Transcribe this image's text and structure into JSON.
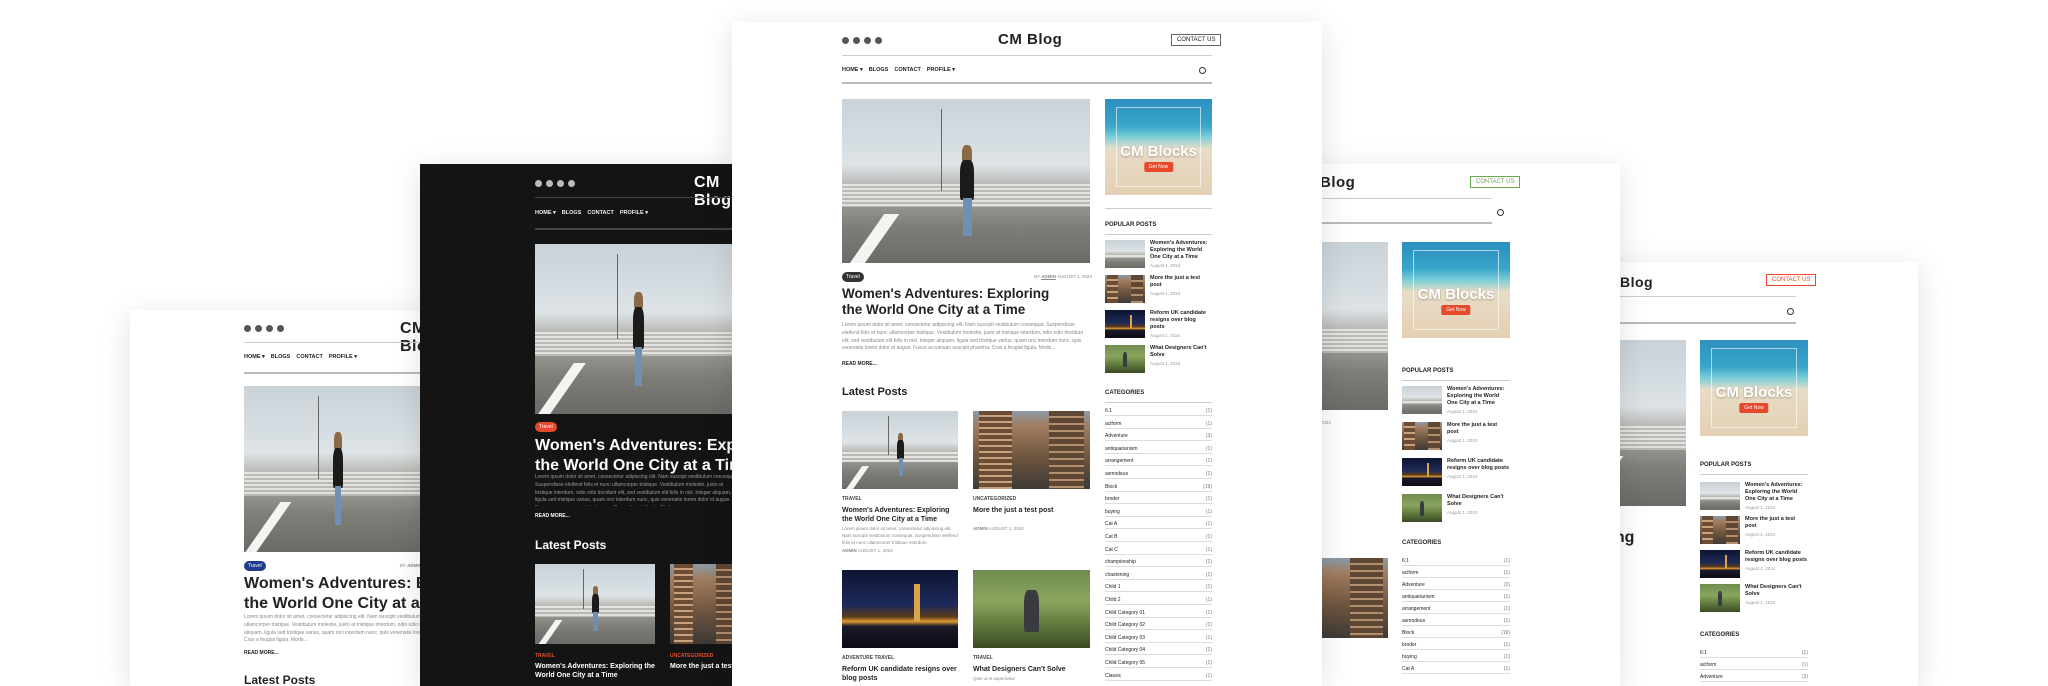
{
  "site": {
    "logo": "CM Blog",
    "contact_label": "CONTACT US",
    "social_icons": [
      "facebook-icon",
      "linkedin-icon",
      "pinterest-icon",
      "instagram-icon"
    ],
    "nav": [
      "HOME ▾",
      "BLOGS",
      "CONTACT",
      "PROFILE ▾"
    ]
  },
  "hero": {
    "category": "Travel",
    "meta_by": "BY",
    "meta_author": "ADMIN",
    "meta_date": "AUGUST 1, 2024",
    "title_line1": "Women's Adventures: Exploring",
    "title_line2": "the World One City at a Time",
    "excerpt": "Lorem ipsum dolor sit amet, consectetur adipiscing elit. Nam suscipit vestibulum consequat. Suspendisse eleifend felis et nunc ullamcorper tristique. Vestibulum molestie, justo at tristique interdum, odio odio tincidunt elit, sed vestibulum elit felis in nisl. Integer aliquam, ligula sed tristique varius, quam orci interdum nunc, quis venenatis lorem dolor id augue. Fusce accumsan suscipit pharetra. Cras a feugiat ligula, Morbi...",
    "read_more": "READ MORE..."
  },
  "latest": {
    "title": "Latest Posts",
    "posts": [
      {
        "category": "TRAVEL",
        "title": "Women's Adventures: Exploring the World One City at a Time",
        "excerpt": "Lorem ipsum dolor sit amet, consectetur adipiscing elit. Nam suscipit vestibulum consequat. Suspendisse eleifend felis et nunc ullamcorper tristique interdum.",
        "author": "ADMIN",
        "date": "AUGUST 1, 2024"
      },
      {
        "category": "UNCATEGORIZED",
        "title": "More the just a test post",
        "author": "ADMIN",
        "date": "AUGUST 1, 2024"
      },
      {
        "category": "ADVENTURE TRAVEL",
        "title": "Reform UK candidate resigns over blog posts"
      },
      {
        "category": "TRAVEL",
        "title": "What Designers Can't Solve",
        "excerpt": "Quis ut et aspernatur"
      }
    ]
  },
  "banner": {
    "title": "CM Blocks",
    "button": "Get Now"
  },
  "popular": {
    "title": "POPULAR POSTS",
    "items": [
      {
        "title": "Women's Adventures: Exploring the World One City at a Time",
        "date": "August 1, 2024"
      },
      {
        "title": "More the just a test post",
        "date": "August 1, 2024"
      },
      {
        "title": "Reform UK candidate resigns over blog posts",
        "date": "August 1, 2024"
      },
      {
        "title": "What Designers Can't Solve",
        "date": "August 1, 2024"
      }
    ]
  },
  "categories": {
    "title": "CATEGORIES",
    "items": [
      {
        "name": "6:1",
        "count": "(1)"
      },
      {
        "name": "aciform",
        "count": "(1)"
      },
      {
        "name": "Adventure",
        "count": "(3)"
      },
      {
        "name": "antiquarianism",
        "count": "(1)"
      },
      {
        "name": "arrangement",
        "count": "(1)"
      },
      {
        "name": "asmodeus",
        "count": "(1)"
      },
      {
        "name": "Block",
        "count": "(19)"
      },
      {
        "name": "broder",
        "count": "(1)"
      },
      {
        "name": "buying",
        "count": "(1)"
      },
      {
        "name": "Cat A",
        "count": "(1)"
      },
      {
        "name": "Cat B",
        "count": "(1)"
      },
      {
        "name": "Cat C",
        "count": "(1)"
      },
      {
        "name": "championship",
        "count": "(1)"
      },
      {
        "name": "chastening",
        "count": "(1)"
      },
      {
        "name": "Child 1",
        "count": "(1)"
      },
      {
        "name": "Child 2",
        "count": "(1)"
      },
      {
        "name": "Child Category 01",
        "count": "(1)"
      },
      {
        "name": "Child Category 02",
        "count": "(1)"
      },
      {
        "name": "Child Category 03",
        "count": "(1)"
      },
      {
        "name": "Child Category 04",
        "count": "(1)"
      },
      {
        "name": "Child Category 05",
        "count": "(1)"
      },
      {
        "name": "Classic",
        "count": "(1)"
      }
    ]
  }
}
